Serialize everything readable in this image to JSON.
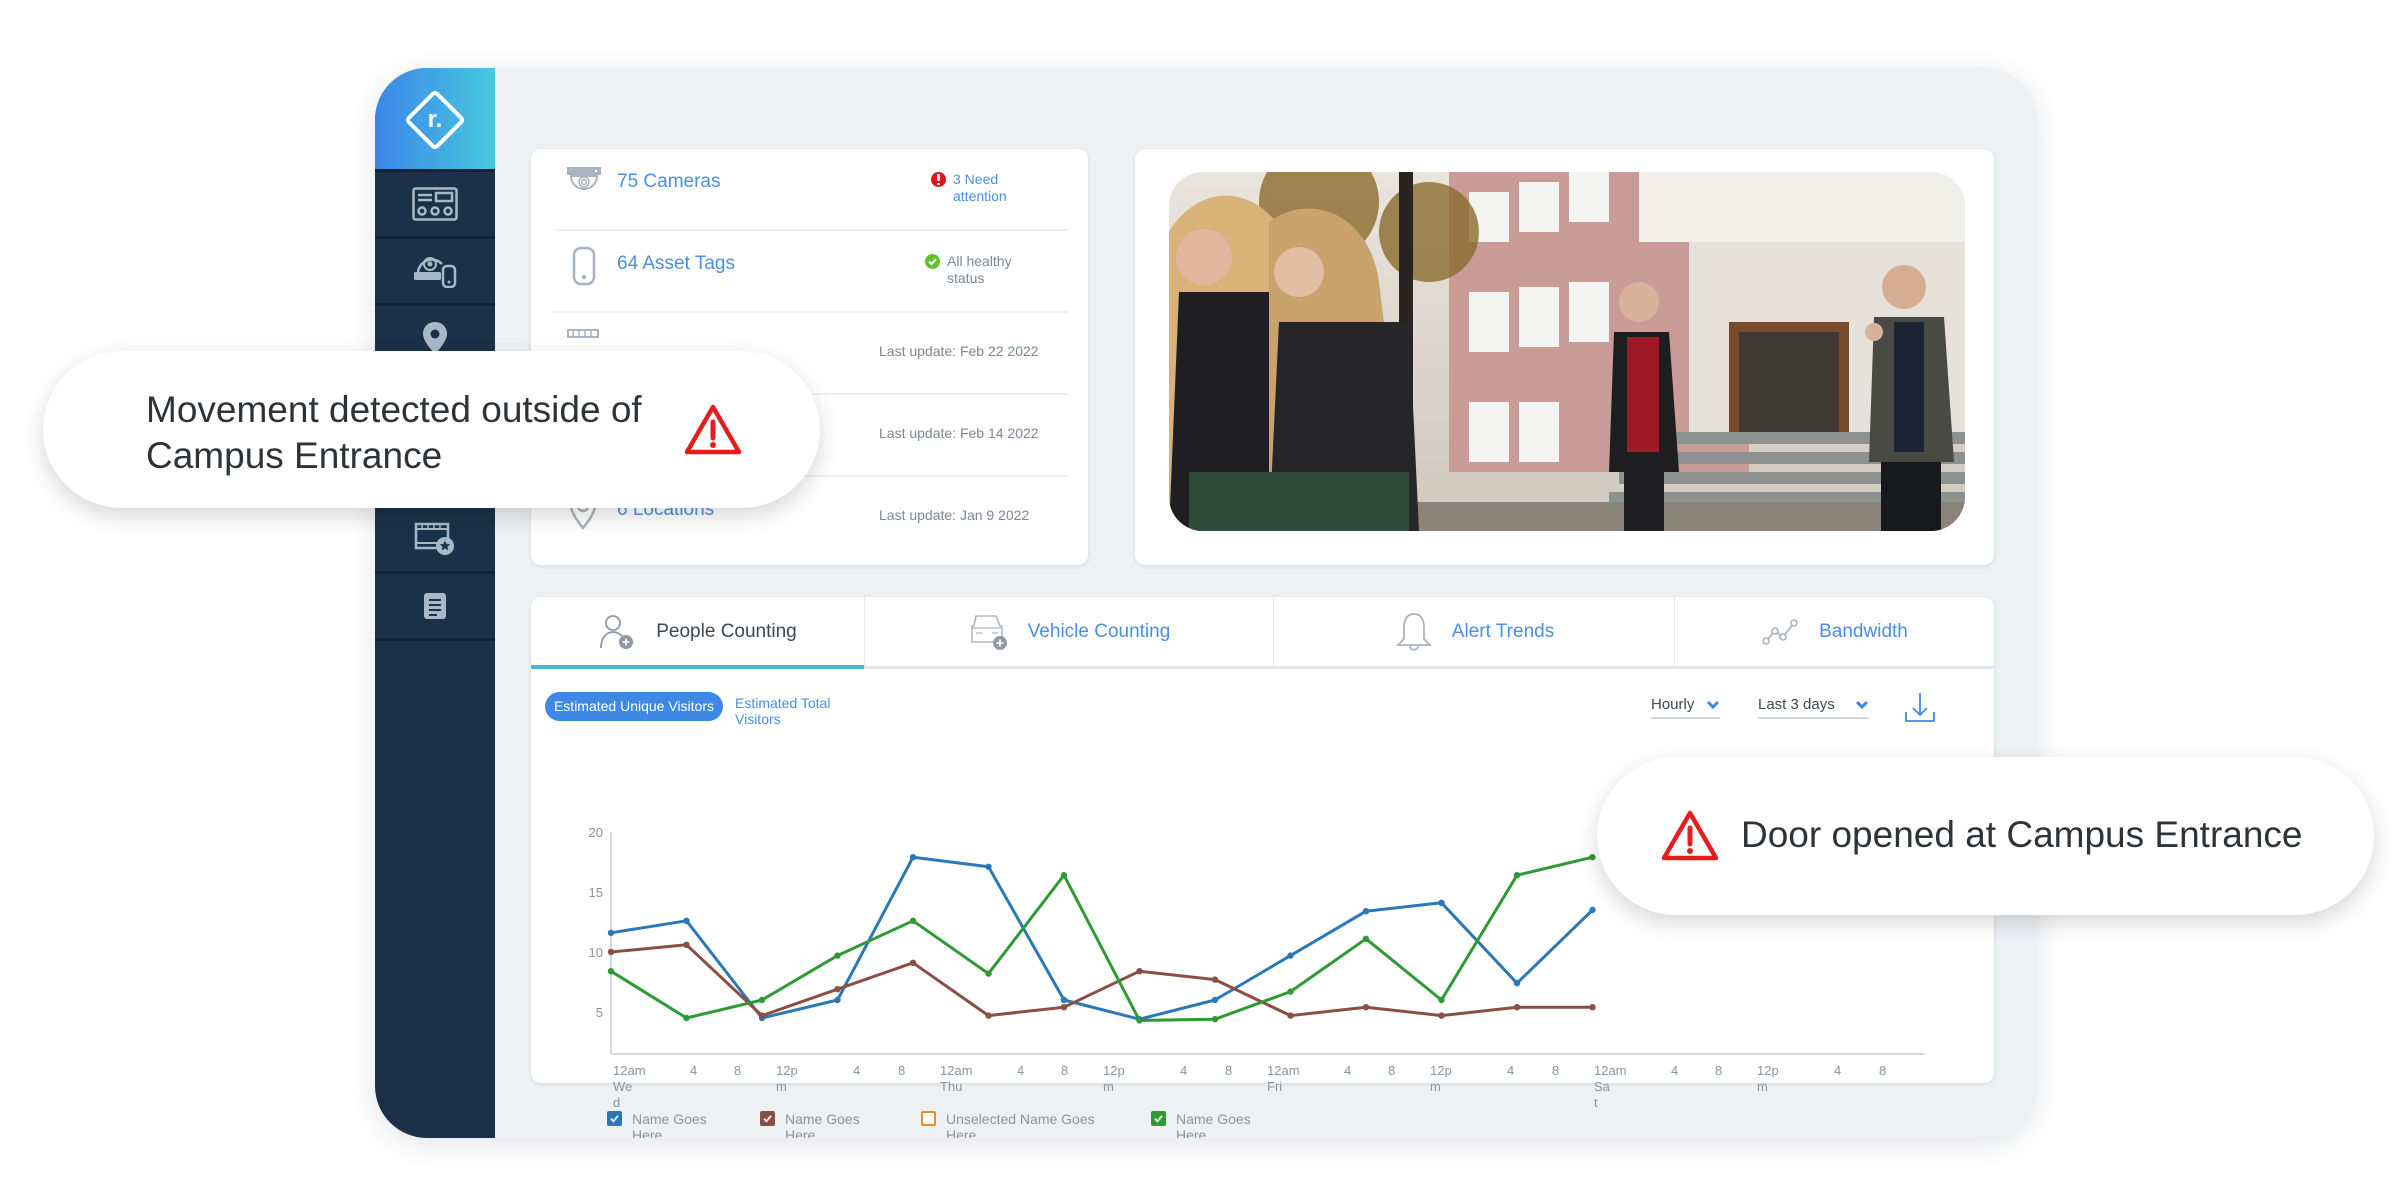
{
  "brand": {
    "logo_text": "r.",
    "gradient_start": "#3b86e8",
    "gradient_end": "#47c9df"
  },
  "sidebar": {
    "items": [
      {
        "name": "devices",
        "icon": "rack-panel-icon"
      },
      {
        "name": "cameras-and-tags",
        "icon": "camera-tag-icon"
      },
      {
        "name": "locations",
        "icon": "location-pin-icon"
      },
      {
        "name": "item-4",
        "icon": "hidden-icon"
      },
      {
        "name": "item-5",
        "icon": "hidden-icon"
      },
      {
        "name": "video-favorites",
        "icon": "film-star-icon"
      },
      {
        "name": "reports",
        "icon": "document-icon"
      }
    ]
  },
  "summary": {
    "rows": [
      {
        "icon": "dome-camera-icon",
        "title": "75 Cameras",
        "status": "3 Need attention",
        "status_type": "alert"
      },
      {
        "icon": "asset-tag-icon",
        "title": "64 Asset Tags",
        "status": "All healthy status",
        "status_type": "ok"
      },
      {
        "icon": "network-switch-icon",
        "title": "",
        "status": "Last update: Feb 22 2022",
        "status_type": "update"
      },
      {
        "icon": "hidden-icon",
        "title": "",
        "status": "Last update: Feb 14 2022",
        "status_type": "update"
      },
      {
        "icon": "location-icon",
        "title": "6 Locations",
        "status": "Last update: Jan 9 2022",
        "status_type": "update"
      }
    ]
  },
  "photo": {
    "description": "Students walking out of a campus building entrance"
  },
  "tabs": [
    {
      "label": "People Counting",
      "icon": "person-add-icon",
      "active": true
    },
    {
      "label": "Vehicle Counting",
      "icon": "car-add-icon",
      "active": false
    },
    {
      "label": "Alert Trends",
      "icon": "bell-icon",
      "active": false
    },
    {
      "label": "Bandwidth",
      "icon": "line-graph-icon",
      "active": false
    }
  ],
  "controls": {
    "metric_selected": "Estimated Unique Visitors",
    "metric_other": "Estimated Total Visitors",
    "interval": "Hourly",
    "range": "Last 3 days",
    "download_icon": "download-icon"
  },
  "chart_data": {
    "type": "line",
    "title": "",
    "xlabel": "",
    "ylabel": "",
    "ylim": [
      1.5,
      20
    ],
    "yticks": [
      5,
      10,
      15,
      20
    ],
    "grid": false,
    "x_tick_labels": [
      [
        "12am",
        "We",
        "d"
      ],
      [
        "4"
      ],
      [
        "8"
      ],
      [
        "12p",
        "m"
      ],
      [
        "4"
      ],
      [
        "8"
      ],
      [
        "12am",
        "Thu"
      ],
      [
        "4"
      ],
      [
        "8"
      ],
      [
        "12p",
        "m"
      ],
      [
        "4"
      ],
      [
        "8"
      ],
      [
        "12am",
        "Fri"
      ],
      [
        "4"
      ],
      [
        "8"
      ],
      [
        "12p",
        "m"
      ],
      [
        "4"
      ],
      [
        "8"
      ],
      [
        "12am",
        "Sa",
        "t"
      ],
      [
        "4"
      ],
      [
        "8"
      ],
      [
        "12p",
        "m"
      ],
      [
        "4"
      ],
      [
        "8"
      ]
    ],
    "x_tick_hours": [
      0,
      4,
      8,
      12,
      16,
      20,
      24,
      28,
      32,
      36,
      40,
      44,
      48,
      52,
      56,
      60,
      64,
      68,
      72,
      76,
      80,
      84,
      88,
      92
    ],
    "x_point_hours": [
      0,
      5.5,
      11,
      16.5,
      22,
      27.5,
      33,
      38.5,
      44,
      49.5,
      55,
      60.5,
      66,
      71.5
    ],
    "series": [
      {
        "name": "Name Goes Here",
        "color": "#2a78b8",
        "selected": true,
        "values": [
          11.6,
          12.6,
          4.5,
          6.0,
          17.9,
          17.1,
          6.0,
          4.4,
          6.0,
          9.7,
          13.4,
          14.1,
          7.4,
          13.5
        ]
      },
      {
        "name": "Name Goes Here",
        "color": "#8b4e44",
        "selected": true,
        "values": [
          10.0,
          10.6,
          4.7,
          6.9,
          9.1,
          4.7,
          5.4,
          8.4,
          7.7,
          4.7,
          5.4,
          4.7,
          5.4,
          5.4
        ]
      },
      {
        "name": "Unselected Name Goes Here",
        "color": "#f08a24",
        "selected": false,
        "values": []
      },
      {
        "name": "Name Goes Here",
        "color": "#2e9a34",
        "selected": true,
        "values": [
          8.4,
          4.5,
          6.0,
          9.7,
          12.6,
          8.2,
          16.4,
          4.3,
          4.4,
          6.7,
          11.1,
          6.0,
          16.4,
          17.9
        ]
      }
    ],
    "legend_position": "bottom-left"
  },
  "toasts": [
    {
      "text": "Movement detected outside of Campus Entrance",
      "icon": "warning-icon",
      "color": "#e81c1c"
    },
    {
      "text": "Door opened at Campus Entrance",
      "icon": "warning-icon",
      "color": "#e81c1c"
    }
  ]
}
